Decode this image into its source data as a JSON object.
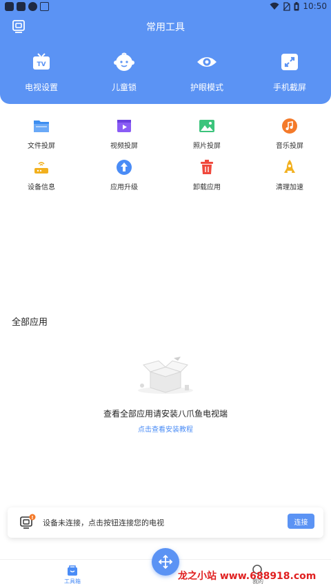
{
  "status_bar": {
    "time": "10:50"
  },
  "header": {
    "title": "常用工具",
    "top_tools": [
      {
        "label": "电视设置",
        "icon": "tv-icon"
      },
      {
        "label": "儿童锁",
        "icon": "child-face-icon"
      },
      {
        "label": "护眼模式",
        "icon": "eye-icon"
      },
      {
        "label": "手机截屏",
        "icon": "screenshot-icon"
      }
    ]
  },
  "tools": [
    {
      "label": "文件投屏",
      "icon": "folder-icon",
      "color": "#3d8ef0"
    },
    {
      "label": "视频投屏",
      "icon": "video-icon",
      "color": "#8a5cf5"
    },
    {
      "label": "照片投屏",
      "icon": "photo-icon",
      "color": "#3cc47c"
    },
    {
      "label": "音乐投屏",
      "icon": "music-icon",
      "color": "#f47a2a"
    },
    {
      "label": "设备信息",
      "icon": "router-icon",
      "color": "#f2b01e"
    },
    {
      "label": "应用升级",
      "icon": "upgrade-icon",
      "color": "#4a8cf6"
    },
    {
      "label": "卸载应用",
      "icon": "trash-icon",
      "color": "#f0483c"
    },
    {
      "label": "清理加速",
      "icon": "rocket-icon",
      "color": "#f2b01e"
    }
  ],
  "all_apps": {
    "title": "全部应用",
    "empty_text": "查看全部应用请安装八爪鱼电视端",
    "link_text": "点击查看安装教程"
  },
  "connect": {
    "badge": "!",
    "text": "设备未连接，点击按钮连接您的电视",
    "button": "连接"
  },
  "bottom_nav": {
    "tools_label": "工具箱",
    "mine_label": "我的"
  },
  "watermark": "龙之小站 www.688918.com"
}
